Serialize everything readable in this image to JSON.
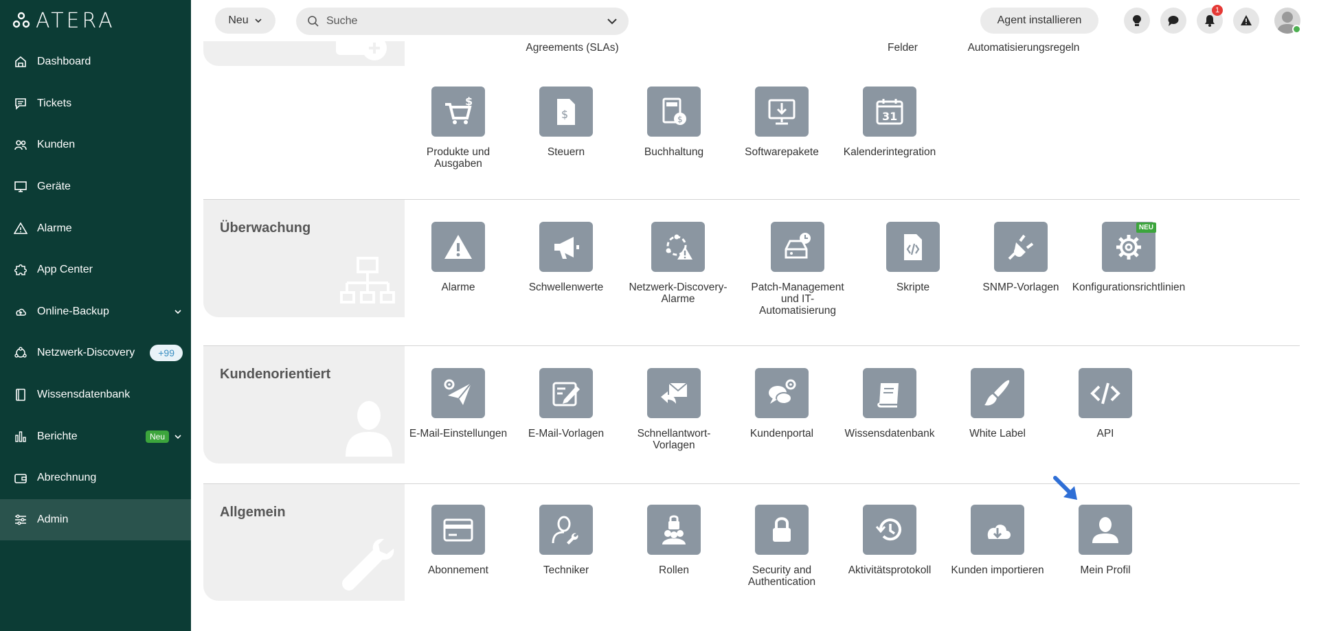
{
  "brand": {
    "name": "ATERA"
  },
  "sidebar": {
    "items": [
      {
        "label": "Dashboard",
        "icon": "home-icon"
      },
      {
        "label": "Tickets",
        "icon": "chat-icon"
      },
      {
        "label": "Kunden",
        "icon": "users-icon"
      },
      {
        "label": "Geräte",
        "icon": "monitor-icon"
      },
      {
        "label": "Alarme",
        "icon": "warning-icon"
      },
      {
        "label": "App Center",
        "icon": "puzzle-icon"
      },
      {
        "label": "Online-Backup",
        "icon": "cloud-icon"
      },
      {
        "label": "Netzwerk-Discovery",
        "icon": "network-icon",
        "pill": "+99"
      },
      {
        "label": "Wissensdatenbank",
        "icon": "book-icon"
      },
      {
        "label": "Berichte",
        "icon": "chart-icon",
        "badge": "Neu"
      },
      {
        "label": "Abrechnung",
        "icon": "wallet-icon"
      },
      {
        "label": "Admin",
        "icon": "sliders-icon",
        "active": true
      }
    ]
  },
  "topbar": {
    "new_label": "Neu",
    "search_placeholder": "Suche",
    "agent_label": "Agent installieren",
    "notif_count": "1"
  },
  "top_partial": {
    "labels": [
      "Agreements (SLAs)",
      "Felder",
      "Automatisierungsregeln"
    ]
  },
  "sections": {
    "billing_row": {
      "tiles": [
        {
          "label": "Produkte und Ausgaben",
          "icon": "cart-icon"
        },
        {
          "label": "Steuern",
          "icon": "tax-document-icon"
        },
        {
          "label": "Buchhaltung",
          "icon": "calculator-icon"
        },
        {
          "label": "Softwarepakete",
          "icon": "download-monitor-icon"
        },
        {
          "label": "Kalenderintegration",
          "icon": "calendar-icon",
          "calendar_day": "31"
        }
      ]
    },
    "monitoring": {
      "title": "Überwachung",
      "tiles": [
        {
          "label": "Alarme",
          "icon": "warning-icon"
        },
        {
          "label": "Schwellenwerte",
          "icon": "megaphone-icon"
        },
        {
          "label": "Netzwerk-Discovery-Alarme",
          "icon": "network-alert-icon"
        },
        {
          "label": "Patch-Management und IT-Automatisierung",
          "icon": "drive-clock-icon"
        },
        {
          "label": "Skripte",
          "icon": "script-icon"
        },
        {
          "label": "SNMP-Vorlagen",
          "icon": "plug-icon"
        },
        {
          "label": "Konfigurationsrichtlinien",
          "icon": "gear-icon",
          "badge": "NEU"
        }
      ]
    },
    "customer": {
      "title": "Kundenorientiert",
      "tiles": [
        {
          "label": "E-Mail-Einstellungen",
          "icon": "email-settings-icon"
        },
        {
          "label": "E-Mail-Vorlagen",
          "icon": "edit-icon"
        },
        {
          "label": "Schnellantwort-Vorlagen",
          "icon": "reply-mail-icon"
        },
        {
          "label": "Kundenportal",
          "icon": "chat-gear-icon"
        },
        {
          "label": "Wissensdatenbank",
          "icon": "book-icon"
        },
        {
          "label": "White Label",
          "icon": "brush-icon"
        },
        {
          "label": "API",
          "icon": "code-icon"
        }
      ]
    },
    "general": {
      "title": "Allgemein",
      "tiles": [
        {
          "label": "Abonnement",
          "icon": "credit-card-icon"
        },
        {
          "label": "Techniker",
          "icon": "technician-icon"
        },
        {
          "label": "Rollen",
          "icon": "roles-lock-icon"
        },
        {
          "label": "Security and Authentication",
          "icon": "lock-icon"
        },
        {
          "label": "Aktivitätsprotokoll",
          "icon": "history-icon"
        },
        {
          "label": "Kunden importieren",
          "icon": "cloud-download-icon"
        },
        {
          "label": "Mein Profil",
          "icon": "user-icon"
        }
      ]
    }
  },
  "colors": {
    "sidebar": "#0c3c35",
    "tile": "#8b96a1",
    "accent": "#2f6fd6"
  }
}
